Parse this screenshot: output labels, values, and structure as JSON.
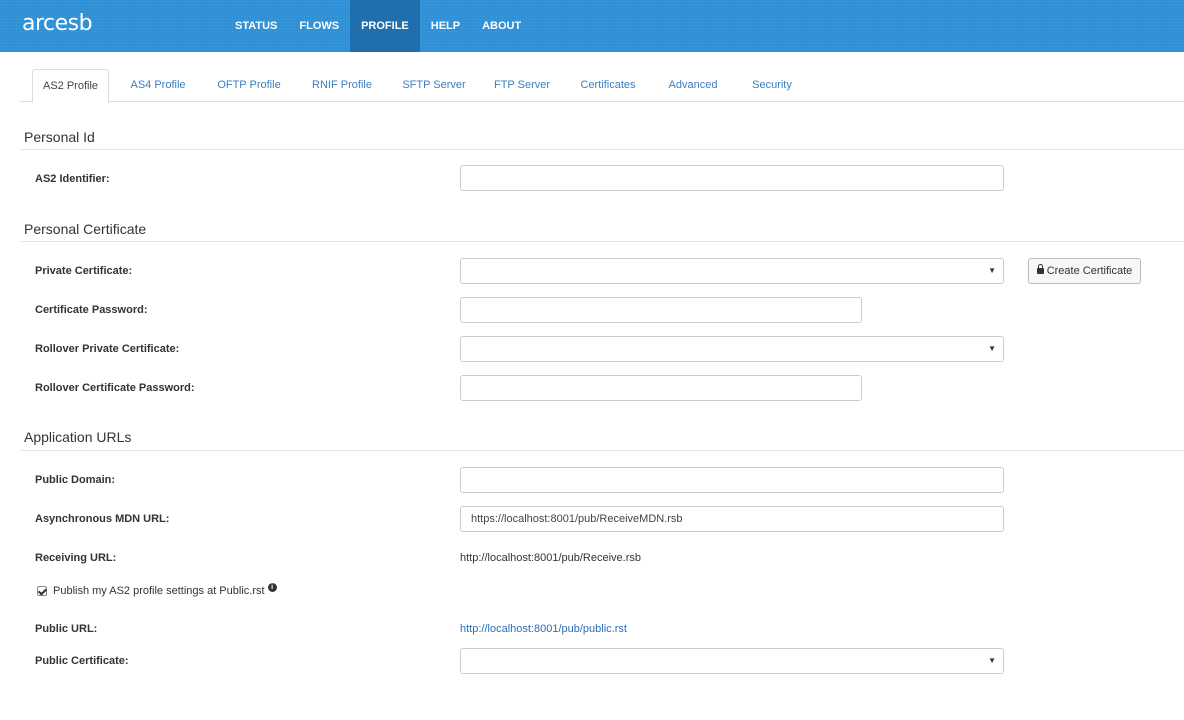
{
  "app": {
    "logo": "arcesb"
  },
  "nav": [
    "STATUS",
    "FLOWS",
    "PROFILE",
    "HELP",
    "ABOUT"
  ],
  "tabs": [
    "AS2 Profile",
    "AS4 Profile",
    "OFTP Profile",
    "RNIF Profile",
    "SFTP Server",
    "FTP Server",
    "Certificates",
    "Advanced",
    "Security"
  ],
  "active_tab": "AS2 Profile",
  "sections": {
    "personal_id": "Personal Id",
    "personal_certificate": "Personal Certificate",
    "application_urls": "Application URLs"
  },
  "fields": {
    "as2_identifier": {
      "label": "AS2 Identifier:",
      "value": ""
    },
    "private_certificate": {
      "label": "Private Certificate:",
      "value": ""
    },
    "certificate_password": {
      "label": "Certificate Password:",
      "value": ""
    },
    "rollover_private_certificate": {
      "label": "Rollover Private Certificate:",
      "value": ""
    },
    "rollover_certificate_password": {
      "label": "Rollover Certificate Password:",
      "value": ""
    },
    "public_domain": {
      "label": "Public Domain:",
      "value": ""
    },
    "async_mdn_url": {
      "label": "Asynchronous MDN URL:",
      "value": "https://localhost:8001/pub/ReceiveMDN.rsb"
    },
    "receiving_url": {
      "label": "Receiving URL:",
      "value": "http://localhost:8001/pub/Receive.rsb"
    },
    "public_url": {
      "label": "Public URL:",
      "value": "http://localhost:8001/pub/public.rst"
    },
    "public_certificate": {
      "label": "Public Certificate:",
      "value": ""
    }
  },
  "buttons": {
    "create_certificate": "Create Certificate"
  },
  "publish_checkbox": {
    "label": "Publish my AS2 profile settings at Public.rst",
    "checked": true
  },
  "colors": {
    "header": "#2d8fd5",
    "active_nav": "#1f6fae",
    "link": "#2a6ebb"
  }
}
